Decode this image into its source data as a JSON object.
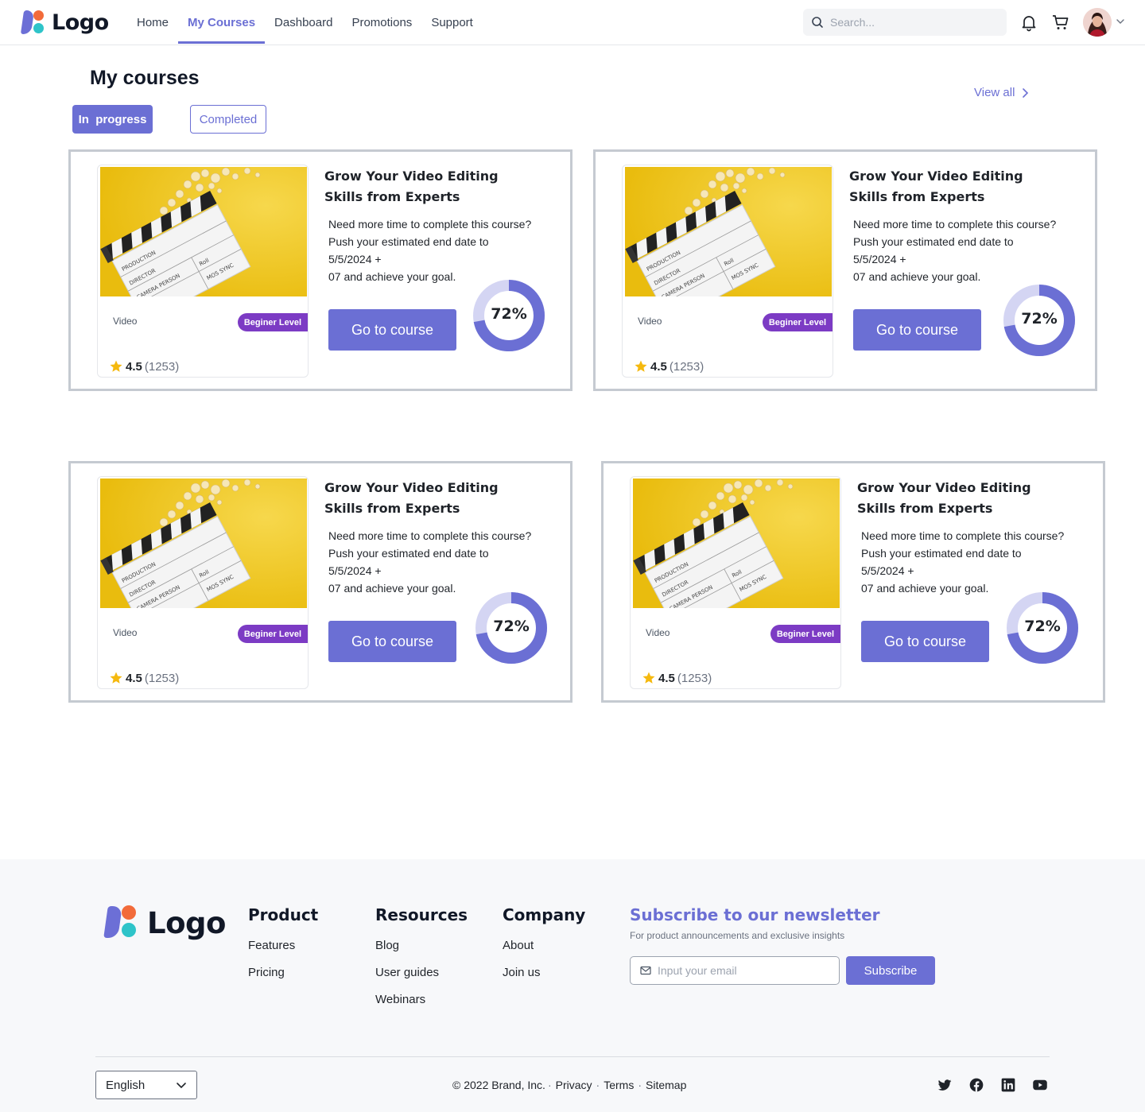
{
  "header": {
    "logo_text": "Logo",
    "nav": [
      "Home",
      "My Courses",
      "Dashboard",
      "Promotions",
      "Support"
    ],
    "active_nav": "My Courses",
    "search_placeholder": "Search..."
  },
  "main": {
    "title": "My courses",
    "view_all": "View all",
    "tabs": {
      "in_progress": "In  progress",
      "completed": "Completed"
    },
    "active_tab": "In  progress",
    "courses": [
      {
        "title_line1": "Grow Your Video Editing",
        "title_line2": "Skills from Experts",
        "desc": [
          "Need more time to complete this course?",
          "Push your estimated end date to",
          "5/5/2024 +",
          "07 and achieve your goal."
        ],
        "category": "Video",
        "level": "Beginer Level",
        "rating": "4.5",
        "rating_count": "(1253)",
        "button": "Go to course",
        "progress_label": "72%",
        "progress": 0.72
      },
      {
        "title_line1": "Grow Your Video Editing",
        "title_line2": "Skills from Experts",
        "desc": [
          "Need more time to complete this course?",
          "Push your estimated end date to",
          "5/5/2024 +",
          "07 and achieve your goal."
        ],
        "category": "Video",
        "level": "Beginer Level",
        "rating": "4.5",
        "rating_count": "(1253)",
        "button": "Go to course",
        "progress_label": "72%",
        "progress": 0.72
      },
      {
        "title_line1": "Grow Your Video Editing",
        "title_line2": "Skills from Experts",
        "desc": [
          "Need more time to complete this course?",
          "Push your estimated end date to",
          "5/5/2024 +",
          "07 and achieve your goal."
        ],
        "category": "Video",
        "level": "Beginer Level",
        "rating": "4.5",
        "rating_count": "(1253)",
        "button": "Go to course",
        "progress_label": "72%",
        "progress": 0.72
      },
      {
        "title_line1": "Grow Your Video Editing",
        "title_line2": "Skills from Experts",
        "desc": [
          "Need more time to complete this course?",
          "Push your estimated end date to",
          "5/5/2024 +",
          "07 and achieve your goal."
        ],
        "category": "Video",
        "level": "Beginer Level",
        "rating": "4.5",
        "rating_count": "(1253)",
        "button": "Go to course",
        "progress_label": "72%",
        "progress": 0.72
      }
    ]
  },
  "footer": {
    "logo_text": "Logo",
    "columns": [
      {
        "heading": "Product",
        "links": [
          "Features",
          "Pricing"
        ]
      },
      {
        "heading": "Resources",
        "links": [
          "Blog",
          "User guides",
          "Webinars"
        ]
      },
      {
        "heading": "Company",
        "links": [
          "About",
          "Join us"
        ]
      }
    ],
    "newsletter": {
      "title": "Subscribe to our newsletter",
      "subtitle": "For product announcements and exclusive insights",
      "email_placeholder": "Input your email",
      "button": "Subscribe"
    },
    "language": "English",
    "copyright": "© 2022 Brand, Inc.",
    "links": [
      "Privacy",
      "Terms",
      "Sitemap"
    ],
    "social": [
      "twitter-icon",
      "facebook-icon",
      "linkedin-icon",
      "youtube-icon"
    ]
  },
  "colors": {
    "accent": "#6b6fd4",
    "badge": "#7c3bc4",
    "track": "#d4d5f3",
    "card_border": "#c5cad1",
    "footer_bg": "#f7f8fa"
  }
}
